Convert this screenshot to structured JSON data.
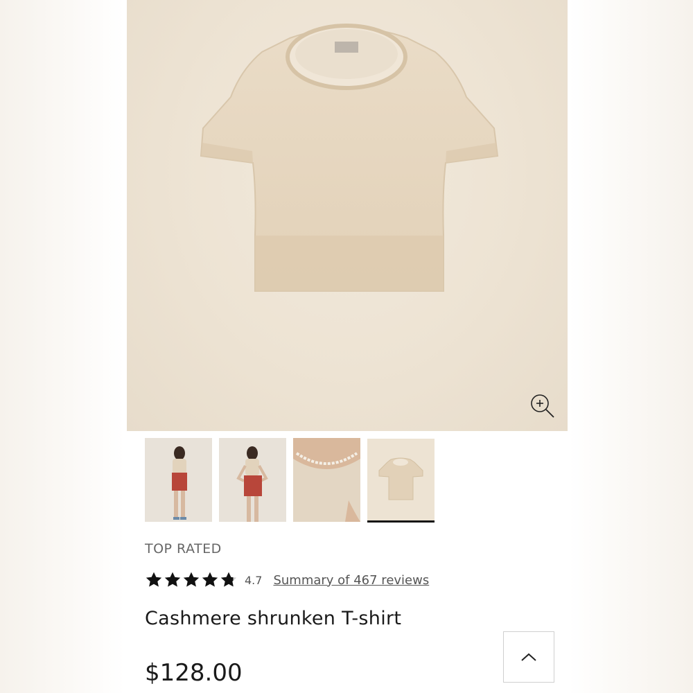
{
  "product": {
    "badge": "TOP RATED",
    "rating_value": "4.7",
    "rating_stars": 4.7,
    "reviews_link": "Summary of 467 reviews",
    "title": "Cashmere shrunken T-shirt",
    "price": "$128.00"
  },
  "gallery": {
    "thumbnails": [
      "model-front",
      "model-hands-on-hips",
      "neckline-closeup",
      "flat-lay"
    ],
    "active_index": 3
  },
  "colors": {
    "background": "#ede3d3",
    "sweater": "#e6d6bf",
    "shorts": "#b8463a",
    "text": "#1a1a1a"
  },
  "icons": {
    "zoom": "zoom-in-icon",
    "back_to_top": "chevron-up-icon",
    "rating": "star-icon"
  }
}
